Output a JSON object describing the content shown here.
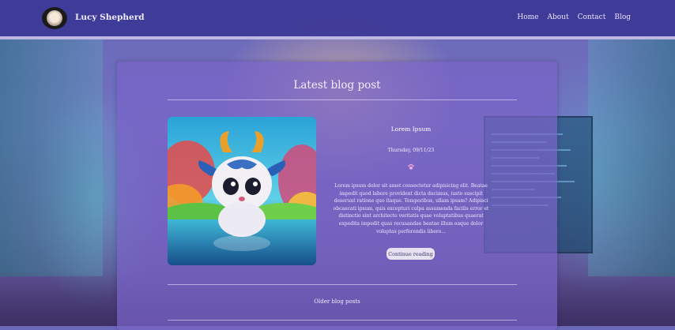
{
  "site": {
    "brand": "Lucy Shepherd"
  },
  "nav": {
    "items": [
      "Home",
      "About",
      "Contact",
      "Blog"
    ]
  },
  "main": {
    "title": "Latest blog post",
    "post": {
      "title": "Lorem Ipsum",
      "date": "Thursday, 09/11/23",
      "body": "Lorem ipsum dolor sit amet consectetur adipisicing elit. Beatae impedit quod labore provident dicta ducimus, iusto suscipit deserunt ratione quo itaque. Temporibus, ullam ipsam? Adipisci obcaecati ipsum, quis excepturi culpa assumenda facilis error et distinctio sint architecto veritatis quae voluptatibus quaerat expedita impedit quas recusandae beatae illum eaque dolor voluptas perferendis libero...",
      "button_label": "Continue reading"
    },
    "older_label": "Older blog posts"
  },
  "icons": {
    "logo": "cat-avatar-icon",
    "separator": "paw-icon"
  },
  "colors": {
    "navbar": "#3c3796",
    "card": "#7864c8",
    "button": "#e6e2f2"
  }
}
